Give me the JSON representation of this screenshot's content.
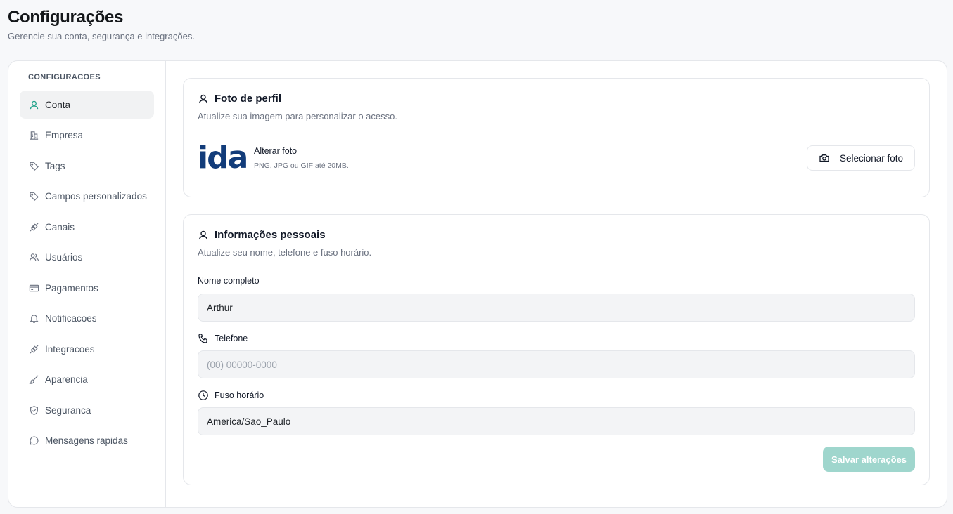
{
  "header": {
    "title": "Configurações",
    "subtitle": "Gerencie sua conta, segurança e integrações."
  },
  "sidebar": {
    "heading": "CONFIGURACOES",
    "active_index": 0,
    "items": [
      {
        "label": "Conta",
        "icon": "user-icon"
      },
      {
        "label": "Empresa",
        "icon": "building-icon"
      },
      {
        "label": "Tags",
        "icon": "tag-icon"
      },
      {
        "label": "Campos personalizados",
        "icon": "tag-icon"
      },
      {
        "label": "Canais",
        "icon": "plug-icon"
      },
      {
        "label": "Usuários",
        "icon": "users-icon"
      },
      {
        "label": "Pagamentos",
        "icon": "credit-card-icon"
      },
      {
        "label": "Notificacoes",
        "icon": "bell-icon"
      },
      {
        "label": "Integracoes",
        "icon": "plug-icon"
      },
      {
        "label": "Aparencia",
        "icon": "brush-icon"
      },
      {
        "label": "Seguranca",
        "icon": "shield-icon"
      },
      {
        "label": "Mensagens rapidas",
        "icon": "message-icon"
      }
    ]
  },
  "profile_photo": {
    "title": "Foto de perfil",
    "description": "Atualize sua imagem para personalizar o acesso.",
    "avatar_text": "ida",
    "change_label": "Alterar foto",
    "hint": "PNG, JPG ou GIF até 20MB.",
    "select_button": "Selecionar foto"
  },
  "personal_info": {
    "title": "Informações pessoais",
    "description": "Atualize seu nome, telefone e fuso horário.",
    "name_label": "Nome completo",
    "name_value": "Arthur",
    "phone_label": "Telefone",
    "phone_placeholder": "(00) 00000-0000",
    "timezone_label": "Fuso horário",
    "timezone_value": "America/Sao_Paulo",
    "save_button": "Salvar alterações"
  },
  "colors": {
    "accent": "#22a38a",
    "save_button_bg": "#9fd6cd",
    "avatar_text": "#123c7a"
  }
}
